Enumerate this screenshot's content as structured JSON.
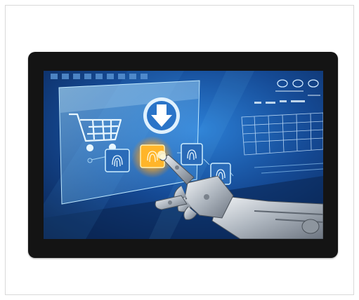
{
  "product": {
    "type": "touchscreen-monitor",
    "bezel_color": "#141414",
    "screen_theme": [
      "#0b2a5a",
      "#1f6fc0",
      "#7fd3ff"
    ]
  },
  "screen_content": {
    "scene": "robot-hand-touching-holographic-interface",
    "icons": [
      "shopping-cart-icon",
      "download-arrow-icon",
      "fingerprint-icon",
      "fingerprint-icon",
      "fingerprint-icon"
    ],
    "highlight_color": "#ffb52a"
  }
}
